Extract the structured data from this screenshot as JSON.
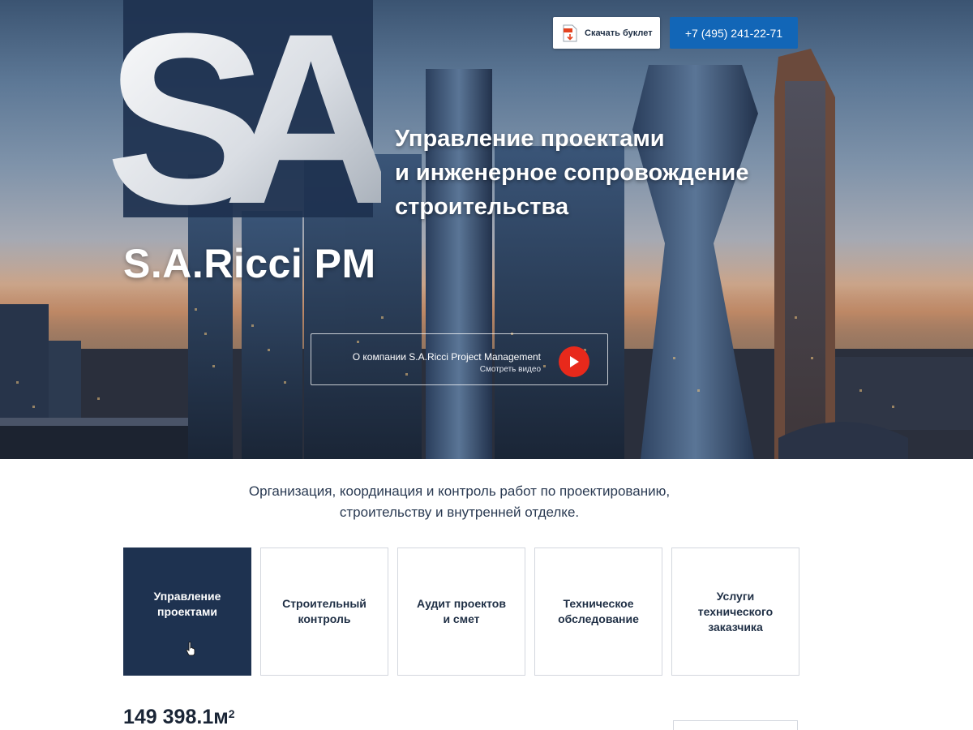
{
  "header": {
    "booklet_button": "Скачать буклет",
    "phone_button": "+7 (495) 241-22-71",
    "booklet_icon": "pdf-file-icon"
  },
  "hero": {
    "logo_letters": "SA",
    "brand_name": "S.A.Ricci PM",
    "headline_lines": [
      "Управление проектами",
      "и инженерное сопровождение",
      "строительства"
    ],
    "video": {
      "title": "О компании S.A.Ricci Project Management",
      "subtitle": "Смотреть видео",
      "icon": "play-icon"
    }
  },
  "intro": {
    "lines": [
      "Организация, координация и контроль работ по проектированию,",
      "строительству и внутренней отделке."
    ]
  },
  "services": [
    {
      "label": "Управление проектами",
      "active": true
    },
    {
      "label": "Строительный контроль",
      "active": false
    },
    {
      "label": "Аудит проектов и смет",
      "active": false
    },
    {
      "label": "Техническое обследование",
      "active": false
    },
    {
      "label": "Услуги технического заказчика",
      "active": false
    }
  ],
  "stats": {
    "area_value": "149 398.1м",
    "area_unit_sup": "2"
  },
  "colors": {
    "navy": "#1e3250",
    "accent_blue": "#1266b7",
    "play_red": "#e8291b",
    "border_gray": "#d3d7de"
  }
}
